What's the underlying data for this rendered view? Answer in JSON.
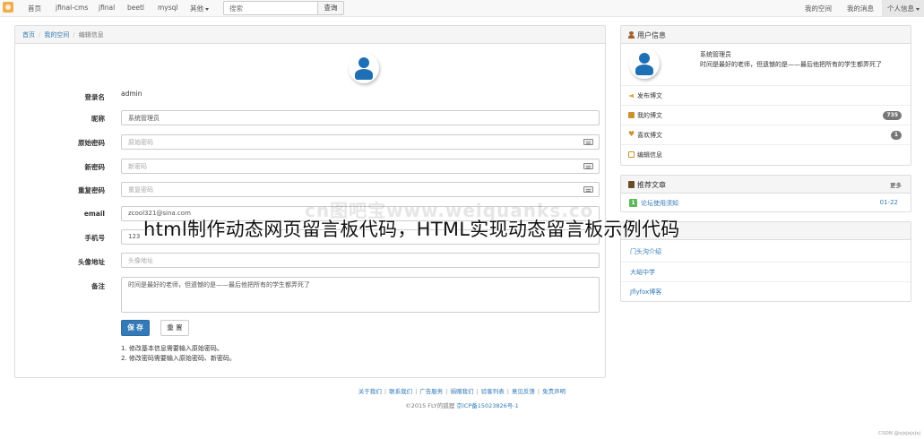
{
  "nav": {
    "items": [
      "首页",
      "jfinal-cms",
      "jfinal",
      "beetl",
      "mysql",
      "其他"
    ],
    "search_placeholder": "搜索",
    "search_button": "查询",
    "right_items": [
      "我的空间",
      "我的消息",
      "个人信息"
    ]
  },
  "breadcrumb": {
    "home": "首页",
    "space": "我的空间",
    "current": "编辑信息"
  },
  "form": {
    "labels": {
      "username": "登录名",
      "nickname": "昵称",
      "old_password": "原始密码",
      "new_password": "新密码",
      "repeat_password": "重复密码",
      "email": "email",
      "phone": "手机号",
      "avatar": "头像地址",
      "remark": "备注"
    },
    "username": "admin",
    "nickname": "系统管理员",
    "old_password_placeholder": "原始密码",
    "new_password_placeholder": "新密码",
    "repeat_password_placeholder": "重复密码",
    "email": "zcool321@sina.com",
    "phone": "123",
    "avatar_placeholder": "头像地址",
    "remark": "时间是最好的老师，但遗憾的是——最后他把所有的学生都弄死了",
    "save_button": "保 存",
    "reset_button": "重 置",
    "notes": [
      "1. 修改基本信息需要输入原始密码。",
      "2. 修改密码需要输入原始密码、新密码。"
    ]
  },
  "user_panel": {
    "title": "用户信息",
    "name": "系统管理员",
    "motto": "时间是最好的老师，但遗憾的是——最后他把所有的学生都弄死了",
    "items": [
      {
        "label": "发布博文",
        "badge": ""
      },
      {
        "label": "我的博文",
        "badge": "735"
      },
      {
        "label": "喜欢博文",
        "badge": "1"
      },
      {
        "label": "编辑信息",
        "badge": ""
      }
    ]
  },
  "recommend_panel": {
    "title": "推荐文章",
    "more": "更多",
    "rank": "1",
    "article": "论坛使用须知",
    "date": "01-22"
  },
  "links_panel": {
    "links": [
      "门头沟介绍",
      "大峪中学",
      "Jflyfox博客"
    ]
  },
  "footer": {
    "links": [
      "关于我们",
      "联系我们",
      "广告服务",
      "捐赠我们",
      "验客列表",
      "意见反馈",
      "免责声明"
    ],
    "copyright": "©2015 FLY的狐狸",
    "icp": "京ICP备15023826号-1"
  },
  "overlay": {
    "title": "html制作动态网页留言板代码，HTML实现动态留言板示例代码",
    "watermark": "cn图吧宝www.weiquanks.co",
    "credit": "CSDN @xjxjxjxjxj"
  },
  "colors": {
    "primary": "#337ab7",
    "avatar": "#1f6fb5",
    "nav_bg": "#f8f8f8"
  }
}
